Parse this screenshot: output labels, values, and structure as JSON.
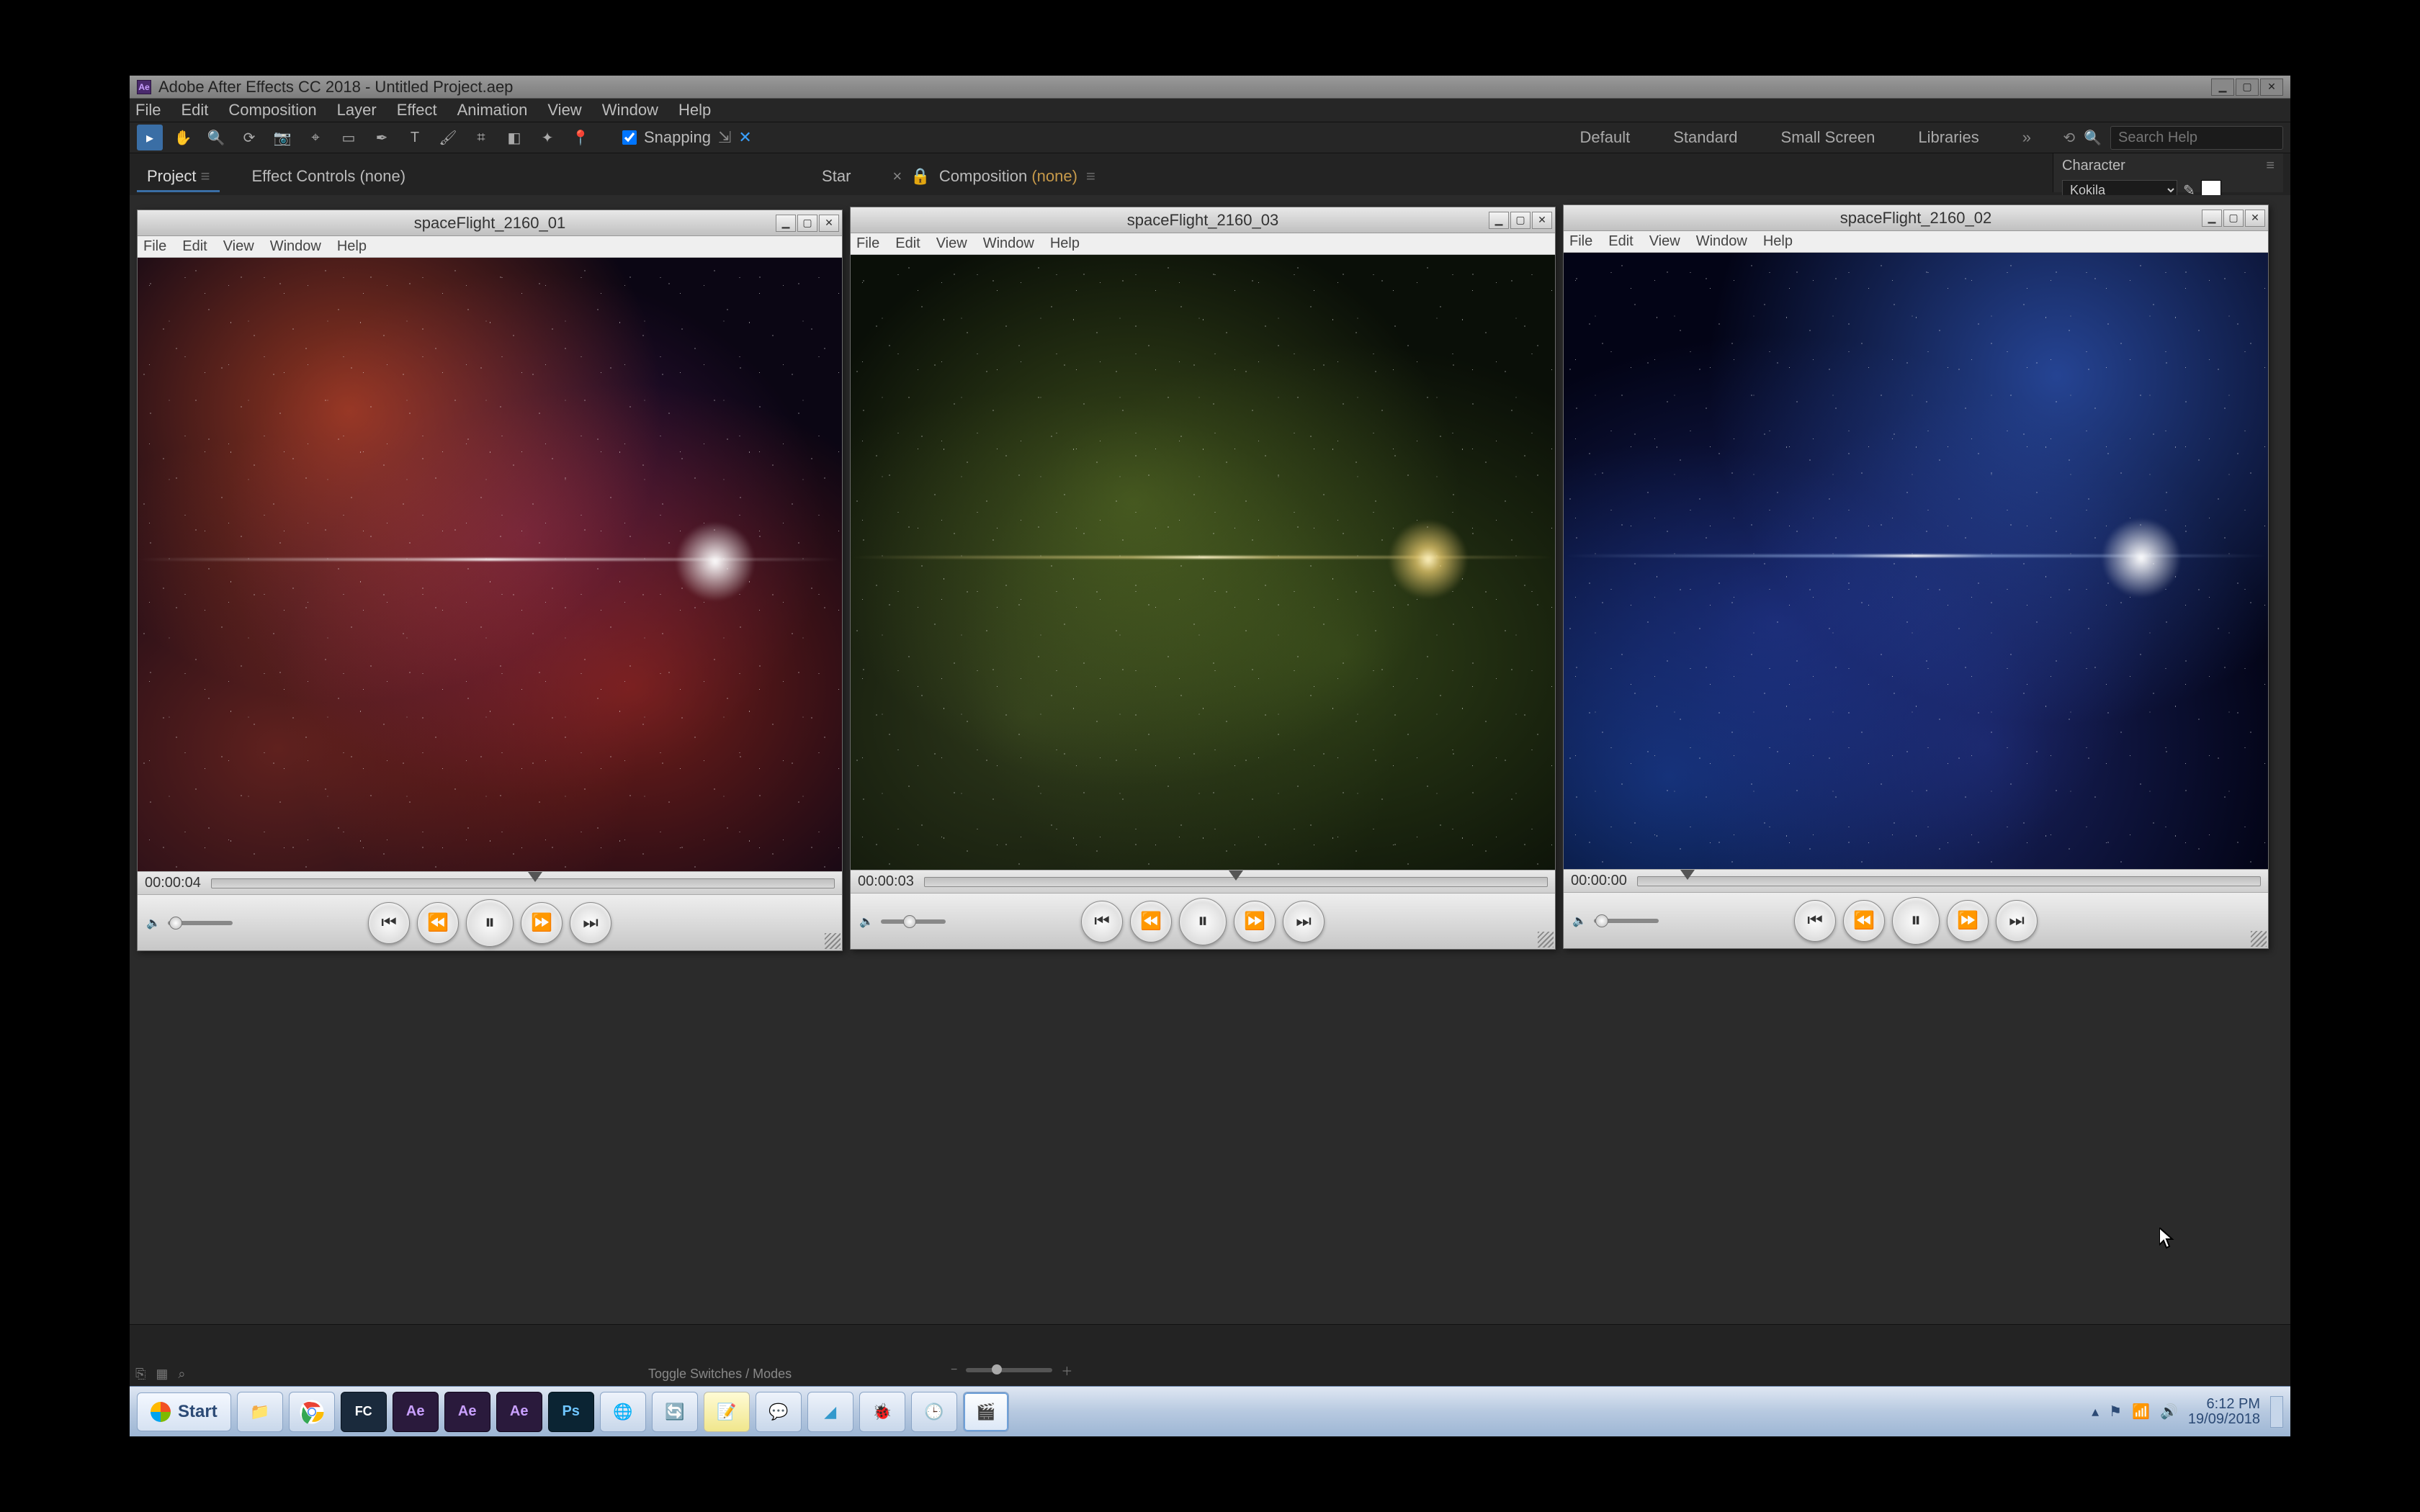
{
  "ae": {
    "title": "Adobe After Effects CC 2018 - Untitled Project.aep",
    "menus": [
      "File",
      "Edit",
      "Composition",
      "Layer",
      "Effect",
      "Animation",
      "View",
      "Window",
      "Help"
    ],
    "snapping_label": "Snapping",
    "workspaces": [
      "Default",
      "Standard",
      "Small Screen",
      "Libraries"
    ],
    "search_placeholder": "Search Help",
    "panel_project": "Project",
    "panel_effect_controls": "Effect Controls (none)",
    "panel_star": "Star",
    "panel_composition": "Composition",
    "panel_composition_none": "(none)",
    "char_panel_label": "Character",
    "char_font": "Kokila",
    "bottom_toggle": "Toggle Switches / Modes"
  },
  "qt_menus": [
    "File",
    "Edit",
    "View",
    "Window",
    "Help"
  ],
  "players": [
    {
      "title": "spaceFlight_2160_01",
      "time": "00:00:04",
      "scrub_pct": 52,
      "vol_pct": 12,
      "flare_x_pct": 82,
      "state": "pause"
    },
    {
      "title": "spaceFlight_2160_03",
      "time": "00:00:03",
      "scrub_pct": 50,
      "vol_pct": 45,
      "flare_x_pct": 82,
      "state": "pause"
    },
    {
      "title": "spaceFlight_2160_02",
      "time": "00:00:00",
      "scrub_pct": 8,
      "vol_pct": 12,
      "flare_x_pct": 82,
      "state": "pause"
    }
  ],
  "taskbar": {
    "start": "Start",
    "time": "6:12 PM",
    "date": "19/09/2018"
  }
}
